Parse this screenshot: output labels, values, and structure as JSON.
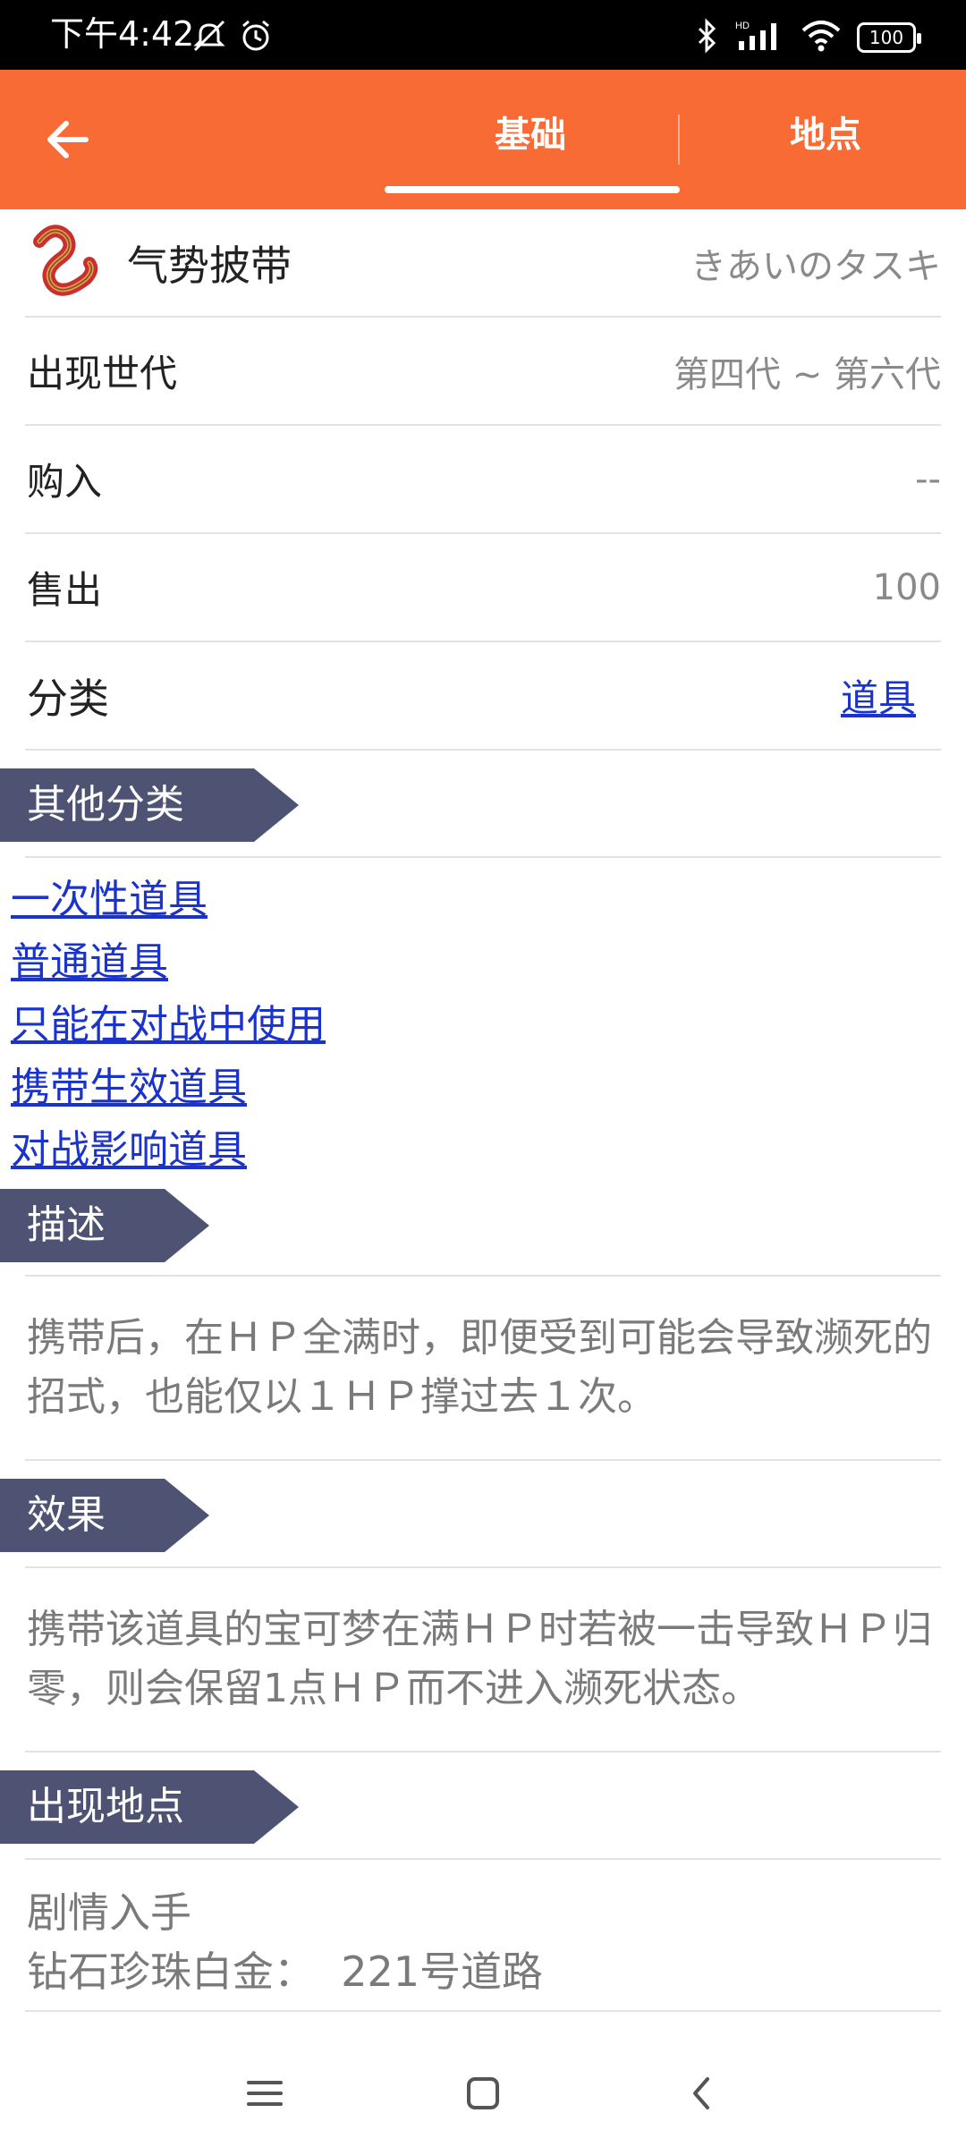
{
  "status": {
    "time": "下午4:42",
    "battery": "100",
    "icons": [
      "mute-icon",
      "alarm-icon",
      "bluetooth-icon",
      "hd-signal-icon",
      "wifi-icon",
      "battery-icon"
    ]
  },
  "app_bar": {
    "back_icon": "back-arrow-icon",
    "tabs": [
      {
        "label": "基础",
        "active": true
      },
      {
        "label": "地点",
        "active": false
      }
    ],
    "colors": {
      "bar": "#f86b34",
      "tag": "#4e5373",
      "link": "#1a33cc"
    }
  },
  "item": {
    "name": "气势披带",
    "japanese_name": "きあいのタスキ",
    "icon": "focus-sash-icon"
  },
  "info": {
    "generation_label": "出现世代",
    "generation_value": "第四代 ~ 第六代",
    "buy_label": "购入",
    "buy_value": "--",
    "sell_label": "售出",
    "sell_value": "100",
    "category_label": "分类",
    "category_value": "道具"
  },
  "sections": {
    "other_categories": {
      "title": "其他分类",
      "items": [
        "一次性道具",
        "普通道具",
        "只能在对战中使用",
        "携带生效道具",
        "对战影响道具"
      ]
    },
    "description": {
      "title": "描述",
      "text": "携带后，在ＨＰ全满时，即便受到可能会导致濒死的招式，也能仅以１ＨＰ撑过去１次。"
    },
    "effect": {
      "title": "效果",
      "text": "携带该道具的宝可梦在满ＨＰ时若被一击导致ＨＰ归零，则会保留1点ＨＰ而不进入濒死状态。"
    },
    "locations": {
      "title": "出现地点",
      "line1": "剧情入手",
      "line2": "钻石珍珠白金：  221号道路"
    }
  },
  "nav": {
    "icons": [
      "menu-icon",
      "home-icon",
      "back-icon"
    ]
  }
}
